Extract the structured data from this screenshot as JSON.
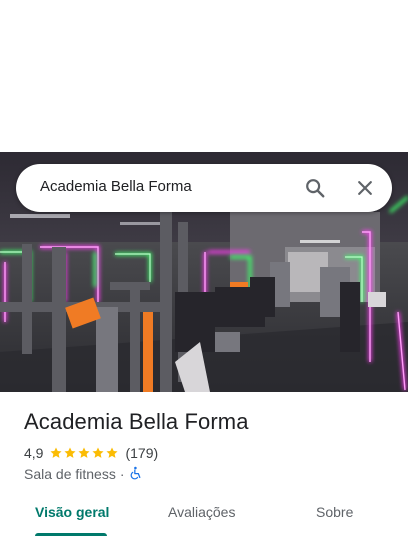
{
  "search": {
    "query": "Academia Bella Forma"
  },
  "place": {
    "name": "Academia Bella Forma",
    "rating": "4,9",
    "rating_value": 4.9,
    "rating_max": 5,
    "review_count": "(179)",
    "category": "Sala de fitness",
    "separator": "·",
    "accessibility": "wheelchair-accessible-icon"
  },
  "tabs": [
    {
      "label": "Visão geral",
      "active": true
    },
    {
      "label": "Avaliações",
      "active": false
    },
    {
      "label": "Sobre",
      "active": false
    }
  ],
  "icons": {
    "search": "search-icon",
    "close": "close-icon",
    "star": "star-icon"
  },
  "colors": {
    "accent": "#00796b",
    "star": "#fbbc04",
    "accessibility": "#1a73e8",
    "neon_pink": "#ff3df5",
    "neon_green": "#3dff6a"
  }
}
